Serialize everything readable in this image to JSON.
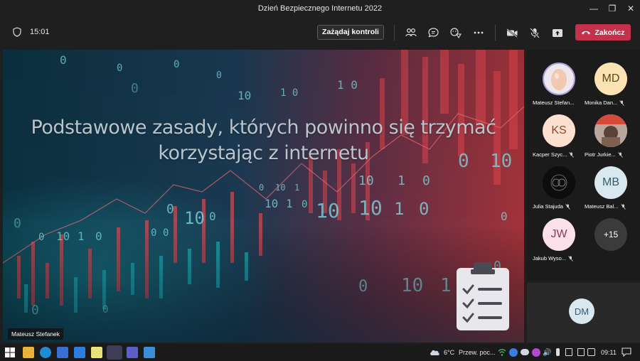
{
  "window": {
    "title": "Dzień Bezpiecznego Internetu 2022"
  },
  "toolbar": {
    "timer": "15:01",
    "request_control_label": "Zażądaj kontroli",
    "end_call_label": "Zakończ",
    "end_color": "#c4314b"
  },
  "stage": {
    "slide_title_line1": "Podstawowe zasady, których powinno się trzymać",
    "slide_title_line2": "korzystając z internetu",
    "presenter_name": "Mateusz Stefanek"
  },
  "participants": [
    {
      "name": "Mateusz Stefan...",
      "initials": "",
      "avatar": "egg-photo",
      "muted": false,
      "bg": "#f2d5c8"
    },
    {
      "name": "Monika Dan...",
      "initials": "MD",
      "avatar": "initials",
      "muted": true,
      "bg": "#fce3b3"
    },
    {
      "name": "Kacper Szyc...",
      "initials": "KS",
      "avatar": "initials",
      "muted": true,
      "bg": "#fde0cf"
    },
    {
      "name": "Piotr Jurkie...",
      "initials": "",
      "avatar": "photo",
      "muted": true,
      "bg": "#c9b9b0"
    },
    {
      "name": "Julia Stajuda",
      "initials": "",
      "avatar": "dark-pattern",
      "muted": true,
      "bg": "#111111"
    },
    {
      "name": "Mateusz Bal...",
      "initials": "MB",
      "avatar": "initials",
      "muted": true,
      "bg": "#d9e7ef"
    },
    {
      "name": "Jakub Wyso...",
      "initials": "JW",
      "avatar": "initials",
      "muted": true,
      "bg": "#fce0ea"
    },
    {
      "name": "",
      "initials": "+15",
      "avatar": "overflow",
      "muted": false,
      "bg": "#3b3b3b"
    }
  ],
  "self_view": {
    "initials": "DM",
    "bg": "#d9e7ef"
  },
  "taskbar": {
    "weather": "6°C",
    "weather_text": "Przew. poc...",
    "time": "09:11"
  }
}
